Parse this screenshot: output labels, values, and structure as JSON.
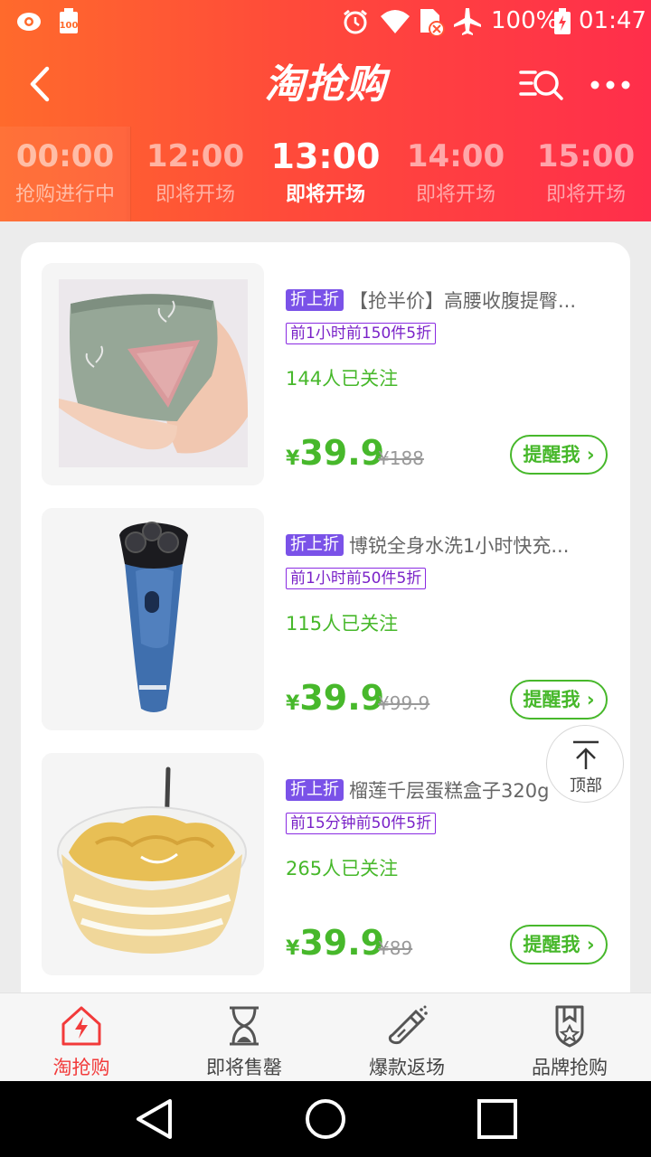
{
  "status_bar": {
    "battery": "100%",
    "time": "01:47",
    "icons": [
      "eye-icon",
      "battery-saver-icon",
      "alarm-icon",
      "wifi-icon",
      "sim-icon",
      "airplane-icon",
      "battery-icon"
    ]
  },
  "header": {
    "title": "淘抢购",
    "back_icon": "back-arrow-icon",
    "search_icon": "search-list-icon",
    "more_icon": "more-dots-icon"
  },
  "time_tabs": [
    {
      "time": "00:00",
      "status": "抢购进行中"
    },
    {
      "time": "12:00",
      "status": "即将开场"
    },
    {
      "time": "13:00",
      "status": "即将开场",
      "active": true
    },
    {
      "time": "14:00",
      "status": "即将开场"
    },
    {
      "time": "15:00",
      "status": "即将开场"
    }
  ],
  "products": [
    {
      "tag": "折上折",
      "title": "【抢半价】高腰收腹提臀...",
      "promo": "前1小时前150件5折",
      "followers": "144人已关注",
      "currency": "¥",
      "price": "39.9",
      "original_price": "¥188",
      "remind_label": "提醒我",
      "image": "underwear-photo"
    },
    {
      "tag": "折上折",
      "title": "博锐全身水洗1小时快充...",
      "promo": "前1小时前50件5折",
      "followers": "115人已关注",
      "currency": "¥",
      "price": "39.9",
      "original_price": "¥99.9",
      "remind_label": "提醒我",
      "image": "electric-shaver-photo"
    },
    {
      "tag": "折上折",
      "title": "榴莲千层蛋糕盒子320g",
      "promo": "前15分钟前50件5折",
      "followers": "265人已关注",
      "currency": "¥",
      "price": "39.9",
      "original_price": "¥89",
      "remind_label": "提醒我",
      "image": "durian-cake-photo"
    }
  ],
  "back_to_top": {
    "label": "顶部"
  },
  "bottom_nav": [
    {
      "label": "淘抢购",
      "icon": "flash-house-icon",
      "active": true
    },
    {
      "label": "即将售罄",
      "icon": "hourglass-icon"
    },
    {
      "label": "爆款返场",
      "icon": "spray-bottle-icon"
    },
    {
      "label": "品牌抢购",
      "icon": "brand-badge-icon"
    }
  ],
  "colors": {
    "header_start": "#ff6a2c",
    "header_end": "#ff2e4b",
    "price_green": "#47b82b",
    "tag_purple": "#7a52e8",
    "nav_active": "#f23a3a"
  }
}
